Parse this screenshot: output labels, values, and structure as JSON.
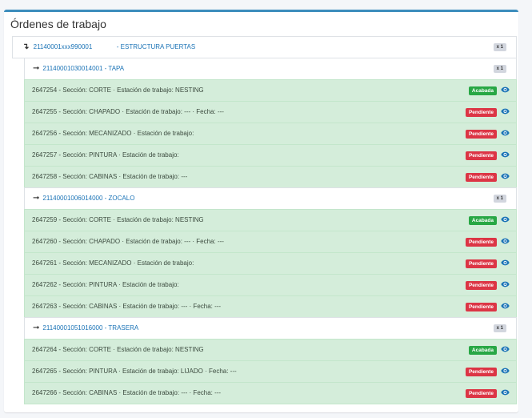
{
  "card": {
    "title": "Órdenes de trabajo"
  },
  "colors": {
    "accent": "#3c8dbc",
    "done": "#28a745",
    "pending": "#dc3545",
    "task_bg": "#d4edda",
    "link": "#1a73b6"
  },
  "tree": {
    "parent": {
      "arrow": "↴",
      "code": "21140001xxx990001",
      "name": "- ESTRUCTURA PUERTAS",
      "qty": "x 1"
    },
    "groups": [
      {
        "arrow": "➞",
        "label": "21140001030014001 - TAPA",
        "qty": "x 1",
        "tasks": [
          {
            "text": "2647254 - Sección: CORTE · Estación de trabajo: NESTING",
            "status": "Acabada"
          },
          {
            "text": "2647255 - Sección: CHAPADO · Estación de trabajo: --- · Fecha: ---",
            "status": "Pendiente"
          },
          {
            "text": "2647256 - Sección: MECANIZADO · Estación de trabajo:",
            "status": "Pendiente"
          },
          {
            "text": "2647257 - Sección: PINTURA · Estación de trabajo:",
            "status": "Pendiente"
          },
          {
            "text": "2647258 - Sección: CABINAS · Estación de trabajo: ---",
            "status": "Pendiente"
          }
        ]
      },
      {
        "arrow": "➞",
        "label": "21140001006014000 - ZOCALO",
        "qty": "x 1",
        "tasks": [
          {
            "text": "2647259 - Sección: CORTE · Estación de trabajo: NESTING",
            "status": "Acabada"
          },
          {
            "text": "2647260 - Sección: CHAPADO · Estación de trabajo: --- · Fecha: ---",
            "status": "Pendiente"
          },
          {
            "text": "2647261 - Sección: MECANIZADO · Estación de trabajo:",
            "status": "Pendiente"
          },
          {
            "text": "2647262 - Sección: PINTURA · Estación de trabajo:",
            "status": "Pendiente"
          },
          {
            "text": "2647263 - Sección: CABINAS · Estación de trabajo: --- · Fecha: ---",
            "status": "Pendiente"
          }
        ]
      },
      {
        "arrow": "➞",
        "label": "21140001051016000 - TRASERA",
        "qty": "x 1",
        "tasks": [
          {
            "text": "2647264 - Sección: CORTE · Estación de trabajo: NESTING",
            "status": "Acabada"
          },
          {
            "text": "2647265 - Sección: PINTURA · Estación de trabajo: LIJADO · Fecha: ---",
            "status": "Pendiente"
          },
          {
            "text": "2647266 - Sección: CABINAS · Estación de trabajo: --- · Fecha: ---",
            "status": "Pendiente"
          }
        ]
      }
    ]
  }
}
